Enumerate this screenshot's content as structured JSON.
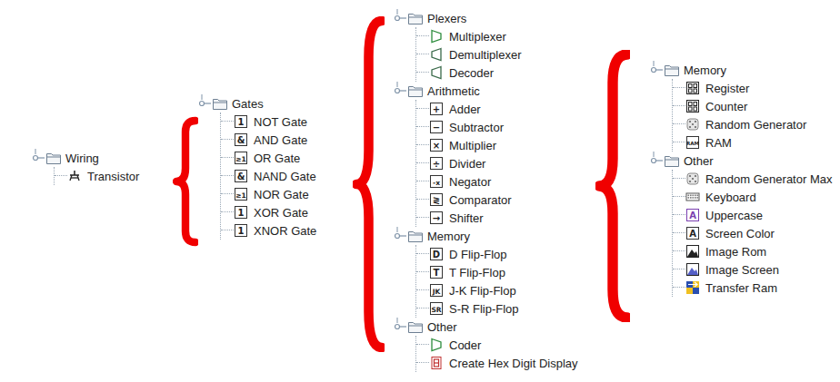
{
  "columns": [
    {
      "folders": [
        {
          "label": "Wiring",
          "expanded": true,
          "items": [
            {
              "label": "Transistor",
              "kind": "transistor"
            }
          ]
        }
      ]
    },
    {
      "folders": [
        {
          "label": "Gates",
          "expanded": true,
          "items": [
            {
              "label": "NOT Gate",
              "kind": "glyph",
              "glyph": "1"
            },
            {
              "label": "AND Gate",
              "kind": "glyph",
              "glyph": "&"
            },
            {
              "label": "OR Gate",
              "kind": "glyph",
              "glyph": "≥1"
            },
            {
              "label": "NAND Gate",
              "kind": "glyph",
              "glyph": "&"
            },
            {
              "label": "NOR Gate",
              "kind": "glyph",
              "glyph": "≥1"
            },
            {
              "label": "XOR Gate",
              "kind": "glyph",
              "glyph": "1"
            },
            {
              "label": "XNOR Gate",
              "kind": "glyph",
              "glyph": "1"
            }
          ]
        }
      ]
    },
    {
      "folders": [
        {
          "label": "Plexers",
          "expanded": true,
          "items": [
            {
              "label": "Multiplexer",
              "kind": "mux"
            },
            {
              "label": "Demultiplexer",
              "kind": "demux"
            },
            {
              "label": "Decoder",
              "kind": "demux"
            }
          ]
        },
        {
          "label": "Arithmetic",
          "expanded": true,
          "items": [
            {
              "label": "Adder",
              "kind": "glyph",
              "glyph": "+"
            },
            {
              "label": "Subtractor",
              "kind": "glyph",
              "glyph": "−"
            },
            {
              "label": "Multiplier",
              "kind": "glyph",
              "glyph": "×"
            },
            {
              "label": "Divider",
              "kind": "glyph",
              "glyph": "÷"
            },
            {
              "label": "Negator",
              "kind": "glyph",
              "glyph": "-x"
            },
            {
              "label": "Comparator",
              "kind": "glyph",
              "glyph": "≷"
            },
            {
              "label": "Shifter",
              "kind": "glyph",
              "glyph": "→"
            }
          ]
        },
        {
          "label": "Memory",
          "expanded": true,
          "items": [
            {
              "label": "D Flip-Flop",
              "kind": "glyph",
              "glyph": "D"
            },
            {
              "label": "T Flip-Flop",
              "kind": "glyph",
              "glyph": "T"
            },
            {
              "label": "J-K Flip-Flop",
              "kind": "glyph",
              "glyph": "JK"
            },
            {
              "label": "S-R Flip-Flop",
              "kind": "glyph",
              "glyph": "SR"
            }
          ]
        },
        {
          "label": "Other",
          "expanded": true,
          "items": [
            {
              "label": "Coder",
              "kind": "mux"
            },
            {
              "label": "Create Hex Digit Display",
              "kind": "display"
            }
          ]
        }
      ]
    },
    {
      "folders": [
        {
          "label": "Memory",
          "expanded": true,
          "items": [
            {
              "label": "Register",
              "kind": "chip"
            },
            {
              "label": "Counter",
              "kind": "chip"
            },
            {
              "label": "Random Generator",
              "kind": "dice"
            },
            {
              "label": "RAM",
              "kind": "glyph",
              "glyph": "RAM"
            }
          ]
        },
        {
          "label": "Other",
          "expanded": true,
          "items": [
            {
              "label": "Random Generator Max",
              "kind": "dice"
            },
            {
              "label": "Keyboard",
              "kind": "keyboard"
            },
            {
              "label": "Uppercase",
              "kind": "glyph",
              "glyph": "A"
            },
            {
              "label": "Screen Color",
              "kind": "glyph",
              "glyph": "A"
            },
            {
              "label": "Image Rom",
              "kind": "image"
            },
            {
              "label": "Image Screen",
              "kind": "image"
            },
            {
              "label": "Transfer Ram",
              "kind": "transfer"
            }
          ]
        }
      ]
    }
  ]
}
